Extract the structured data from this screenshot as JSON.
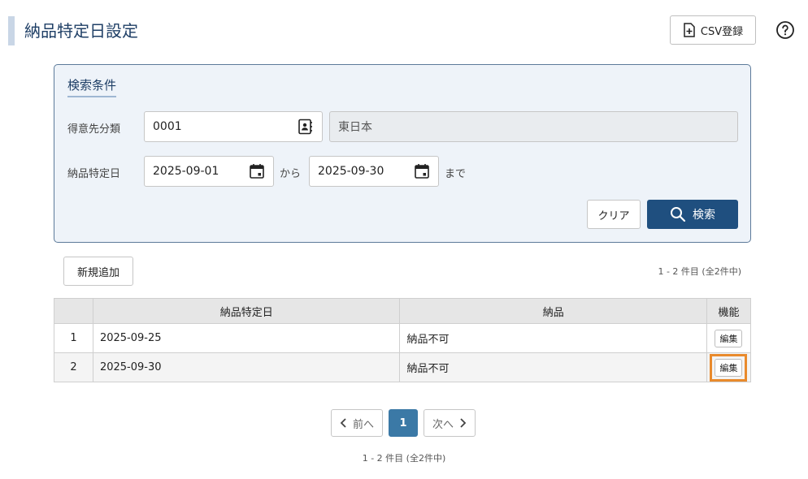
{
  "header": {
    "title": "納品特定日設定",
    "csv_label": "CSV登録"
  },
  "search": {
    "panel_title": "検索条件",
    "customer_label": "得意先分類",
    "customer_code": "0001",
    "customer_name": "東日本",
    "date_label": "納品特定日",
    "date_from": "2025-09-01",
    "from_text": "から",
    "date_to": "2025-09-30",
    "to_text": "まで",
    "clear_label": "クリア",
    "search_label": "検索"
  },
  "list": {
    "new_label": "新規追加",
    "count_text": "1 - 2 件目 (全2件中)",
    "columns": [
      "",
      "納品特定日",
      "納品",
      "機能"
    ],
    "rows": [
      {
        "no": "1",
        "date": "2025-09-25",
        "delivery": "納品不可",
        "action": "編集"
      },
      {
        "no": "2",
        "date": "2025-09-30",
        "delivery": "納品不可",
        "action": "編集"
      }
    ]
  },
  "pagination": {
    "prev_label": "前へ",
    "current_page": "1",
    "next_label": "次へ",
    "count_text": "1 - 2 件目 (全2件中)"
  },
  "colors": {
    "primary": "#1f4f7f",
    "accent_page": "#3b79a6",
    "highlight": "#e98a2c",
    "panel_bg": "#eef3f9"
  },
  "icons": [
    "file-plus-icon",
    "help-circle-icon",
    "address-book-icon",
    "calendar-icon",
    "search-icon",
    "chevron-left-icon",
    "chevron-right-icon"
  ]
}
